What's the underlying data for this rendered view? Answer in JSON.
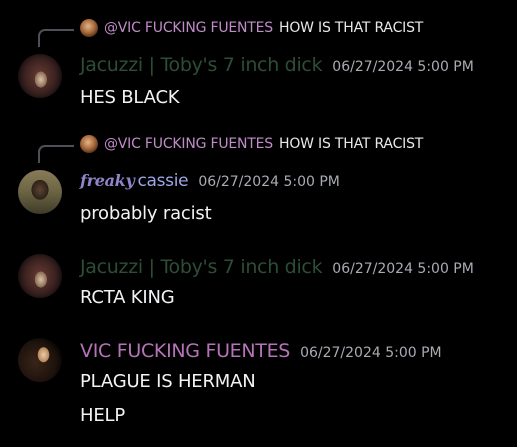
{
  "messages": [
    {
      "reply": {
        "author": "@VIC FUCKING FUENTES",
        "text": "HOW IS THAT RACIST",
        "avatar_icon": "user-avatar"
      },
      "author": "Jacuzzi | Toby's 7 inch dick",
      "timestamp": "06/27/2024 5:00 PM",
      "lines": [
        "HES BLACK"
      ],
      "author_color": "#2e4d36"
    },
    {
      "reply": {
        "author": "@VIC FUCKING FUENTES",
        "text": "HOW IS THAT RACIST",
        "avatar_icon": "user-avatar"
      },
      "author_prefix": "freaky",
      "author": "cassie",
      "timestamp": "06/27/2024 5:00 PM",
      "lines": [
        "probably racist"
      ],
      "author_color": "#9fa7e6"
    },
    {
      "author": "Jacuzzi | Toby's 7 inch dick",
      "timestamp": "06/27/2024 5:00 PM",
      "lines": [
        "RCTA KING"
      ],
      "author_color": "#2e4d36"
    },
    {
      "author": "VIC FUCKING FUENTES",
      "timestamp": "06/27/2024 5:00 PM",
      "lines": [
        "PLAGUE IS HERMAN",
        "HELP"
      ],
      "author_color": "#b574b8"
    }
  ],
  "colors": {
    "background": "#000000",
    "message_text": "#f2f3f5",
    "timestamp": "#a9abb2",
    "reply_line": "#4e5058"
  }
}
